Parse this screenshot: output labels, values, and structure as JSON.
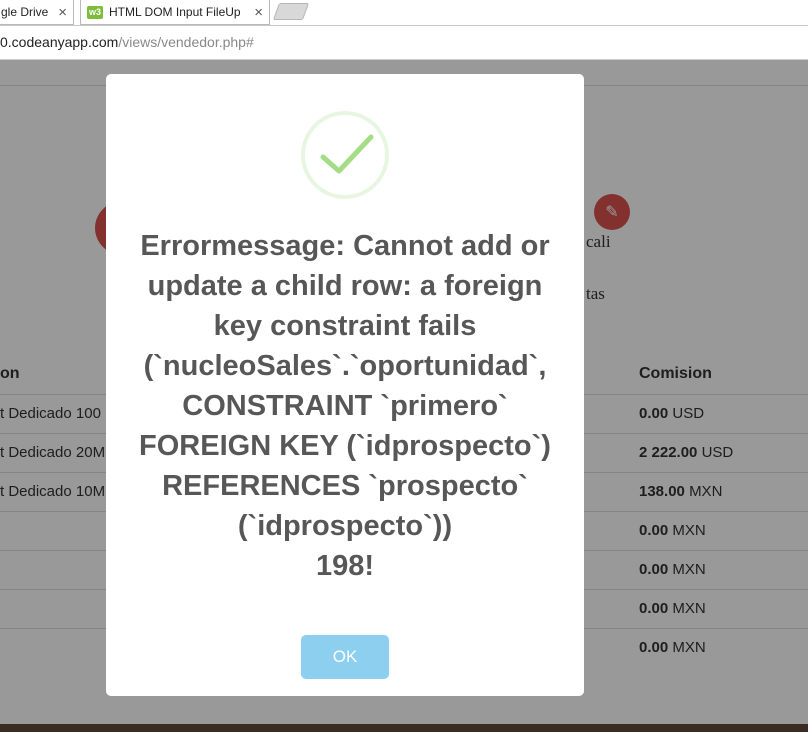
{
  "browser": {
    "tabs": [
      {
        "title": "gle Drive"
      },
      {
        "title": "HTML DOM Input FileUp",
        "favicon": "w3"
      }
    ],
    "url_host": "0.codeanyapp.com",
    "url_path": "/views/vendedor.php#"
  },
  "page": {
    "side_text_1": "cali",
    "side_text_2": "tas",
    "columns": {
      "left": "on",
      "right": "Comision"
    },
    "rows": [
      {
        "left": "t Dedicado 100",
        "amount": "0.00",
        "currency": "USD"
      },
      {
        "left": "t Dedicado 20M",
        "amount": "2 222.00",
        "currency": "USD"
      },
      {
        "left": "t Dedicado 10M",
        "amount": "138.00",
        "currency": "MXN"
      },
      {
        "left": "",
        "amount": "0.00",
        "currency": "MXN"
      },
      {
        "left": "",
        "amount": "0.00",
        "currency": "MXN"
      },
      {
        "left": "",
        "amount": "0.00",
        "currency": "MXN"
      },
      {
        "left": "",
        "amount": "0.00",
        "currency": "MXN"
      }
    ]
  },
  "modal": {
    "icon": "success-check-icon",
    "title_lines": [
      "Errormessage: Cannot add or",
      "update a child row: a foreign",
      "key constraint fails",
      "(`nucleoSales`.`oportunidad`,",
      "CONSTRAINT `primero`",
      "FOREIGN KEY (`idprospecto`)",
      "REFERENCES `prospecto`",
      "(`idprospecto`))",
      "198!"
    ],
    "ok_label": "OK"
  },
  "colors": {
    "confirm_button": "#8ccfef",
    "success_check": "#a5dc86",
    "accent_red": "#d9534f"
  }
}
